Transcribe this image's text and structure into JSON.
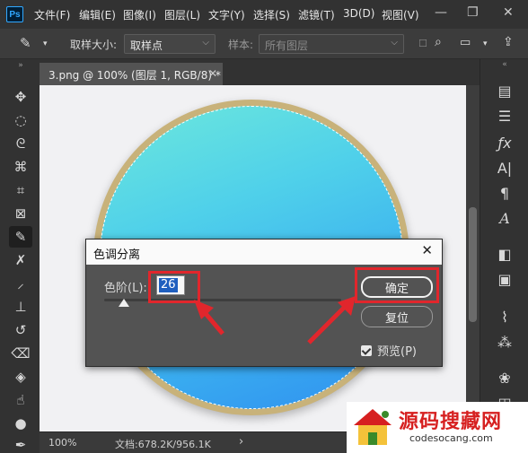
{
  "app": {
    "logo": "Ps",
    "menus": [
      "文件(F)",
      "编辑(E)",
      "图像(I)",
      "图层(L)",
      "文字(Y)",
      "选择(S)",
      "滤镜(T)",
      "3D(D)",
      "视图(V)"
    ]
  },
  "options": {
    "sample_size_label": "取样大小:",
    "sample_size_value": "取样点",
    "sample_label": "样本:",
    "sample_value": "所有图层"
  },
  "document": {
    "tab_title": "3.png @ 100% (图层 1, RGB/8) *"
  },
  "status": {
    "zoom": "100%",
    "doc_info": "文档:678.2K/956.1K",
    "arrow": "›"
  },
  "dialog": {
    "title": "色调分离",
    "level_label": "色阶(L):",
    "level_value": "26",
    "ok_label": "确定",
    "reset_label": "复位",
    "preview_label": "预览(P)",
    "preview_checked": true
  },
  "watermark": {
    "title": "源码搜藏网",
    "url": "codesocang.com"
  },
  "colors": {
    "highlight": "#e1262c",
    "disc_start": "#6de8dc",
    "disc_end": "#2f8fef"
  }
}
